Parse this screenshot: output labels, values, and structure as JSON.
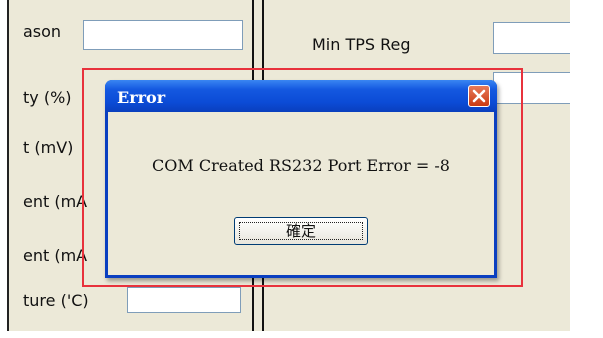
{
  "background_form": {
    "left_labels": [
      "ason",
      "ty (%)",
      "t (mV)",
      "ent (mA",
      "ent (mA",
      "ture ('C)"
    ],
    "right_label": "Min TPS Reg"
  },
  "dialog": {
    "title": "Error",
    "message": "COM Created RS232 Port Error = -8",
    "ok_label": "確定",
    "close_icon": "close-icon"
  },
  "colors": {
    "titlebar": "#0b4bd6",
    "highlight": "#e8323c",
    "window_bg": "#ece9d8"
  }
}
